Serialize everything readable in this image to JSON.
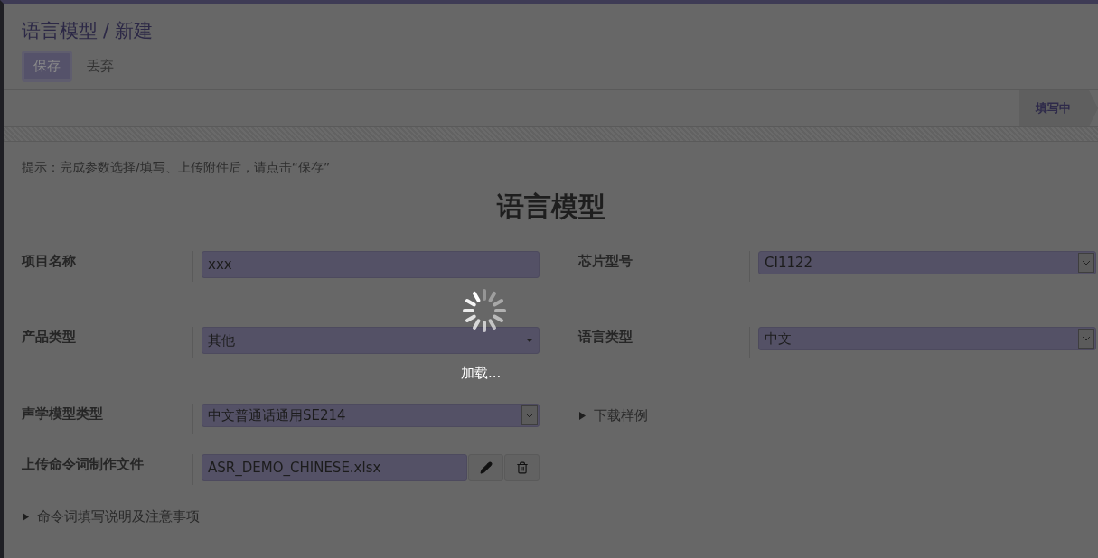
{
  "breadcrumb": {
    "parent": "语言模型",
    "separator": "/",
    "current": "新建"
  },
  "buttons": [
    {
      "kind": "primary",
      "label": "保存"
    },
    {
      "kind": "link",
      "label": "丢弃"
    }
  ],
  "stages": [
    {
      "label": "填写中",
      "selected": true
    }
  ],
  "hint": "提示：完成参数选择/填写、上传附件后，请点击“保存”",
  "form_title": "语言模型",
  "rows": [
    {
      "left": {
        "kind": "text",
        "label": "项目名称",
        "value": "xxx"
      },
      "right": {
        "kind": "select",
        "label": "芯片型号",
        "value": "CI1122"
      }
    },
    {
      "left": {
        "kind": "dropdown",
        "label": "产品类型",
        "value": "其他"
      },
      "right": {
        "kind": "select",
        "label": "语言类型",
        "value": "中文"
      }
    },
    {
      "left": {
        "kind": "select",
        "label": "声学模型类型",
        "value": "中文普通话通用SE214"
      },
      "right": {
        "kind": "expander",
        "label": "下载样例",
        "expanded": false
      }
    },
    {
      "left": {
        "kind": "file",
        "label": "上传命令词制作文件",
        "value": "ASR_DEMO_CHINESE.xlsx"
      }
    }
  ],
  "notes": {
    "label": "命令词填写说明及注意事项",
    "expanded": false
  },
  "loading": {
    "text": "加载..."
  }
}
